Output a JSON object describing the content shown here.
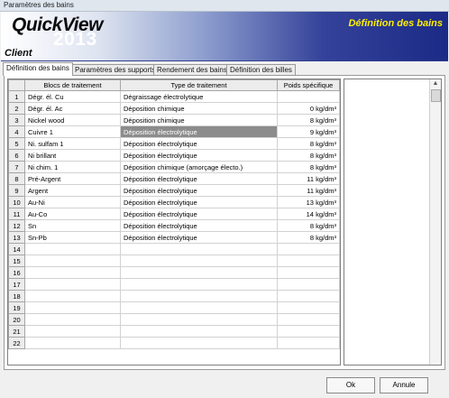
{
  "window": {
    "title": "Paramètres des bains"
  },
  "banner": {
    "logo_text": "QuickView",
    "logo_year": "2013",
    "client_label": "Client",
    "page_title": "Définition des bains"
  },
  "tabs": [
    {
      "label": "Définition des bains"
    },
    {
      "label": "Paramètres des supports"
    },
    {
      "label": "Rendement des bains"
    },
    {
      "label": "Définition des billes"
    }
  ],
  "table": {
    "columns": [
      "Blocs de traitement",
      "Type de traitement",
      "Poids spécifique"
    ],
    "rows": [
      {
        "num": "1",
        "bloc": "Dégr. él. Cu",
        "type": "Dégraissage électrolytique",
        "poids": ""
      },
      {
        "num": "2",
        "bloc": "Dégr. él. Ac",
        "type": "Déposition chimique",
        "poids": "0 kg/dm³"
      },
      {
        "num": "3",
        "bloc": "Nickel wood",
        "type": "Déposition chimique",
        "poids": "8 kg/dm³"
      },
      {
        "num": "4",
        "bloc": "Cuivre 1",
        "type": "Déposition électrolytique",
        "poids": "9 kg/dm³"
      },
      {
        "num": "5",
        "bloc": "Ni. sulfam 1",
        "type": "Déposition électrolytique",
        "poids": "8 kg/dm³"
      },
      {
        "num": "6",
        "bloc": "Ni brillant",
        "type": "Déposition électrolytique",
        "poids": "8 kg/dm³"
      },
      {
        "num": "7",
        "bloc": "Ni chim. 1",
        "type": "Déposition chimique (amorçage électo.)",
        "poids": "8 kg/dm³"
      },
      {
        "num": "8",
        "bloc": "Pré-Argent",
        "type": "Déposition électrolytique",
        "poids": "11 kg/dm³"
      },
      {
        "num": "9",
        "bloc": "Argent",
        "type": "Déposition électrolytique",
        "poids": "11 kg/dm³"
      },
      {
        "num": "10",
        "bloc": "Au-Ni",
        "type": "Déposition électrolytique",
        "poids": "13 kg/dm³"
      },
      {
        "num": "11",
        "bloc": "Au-Co",
        "type": "Déposition électrolytique",
        "poids": "14 kg/dm³"
      },
      {
        "num": "12",
        "bloc": "Sn",
        "type": "Déposition électrolytique",
        "poids": "8 kg/dm³"
      },
      {
        "num": "13",
        "bloc": "Sn-Pb",
        "type": "Déposition électrolytique",
        "poids": "8 kg/dm³"
      },
      {
        "num": "14",
        "bloc": "",
        "type": "",
        "poids": ""
      },
      {
        "num": "15",
        "bloc": "",
        "type": "",
        "poids": ""
      },
      {
        "num": "16",
        "bloc": "",
        "type": "",
        "poids": ""
      },
      {
        "num": "17",
        "bloc": "",
        "type": "",
        "poids": ""
      },
      {
        "num": "18",
        "bloc": "",
        "type": "",
        "poids": ""
      },
      {
        "num": "19",
        "bloc": "",
        "type": "",
        "poids": ""
      },
      {
        "num": "20",
        "bloc": "",
        "type": "",
        "poids": ""
      },
      {
        "num": "21",
        "bloc": "",
        "type": "",
        "poids": ""
      },
      {
        "num": "22",
        "bloc": "",
        "type": "",
        "poids": ""
      }
    ],
    "selected_row": "4"
  },
  "buttons": {
    "ok": "Ok",
    "cancel": "Annule"
  },
  "colors": {
    "banner_dark": "#1b2a86",
    "title_yellow": "#ffee00",
    "selected_cell": "#8c8c8c"
  }
}
